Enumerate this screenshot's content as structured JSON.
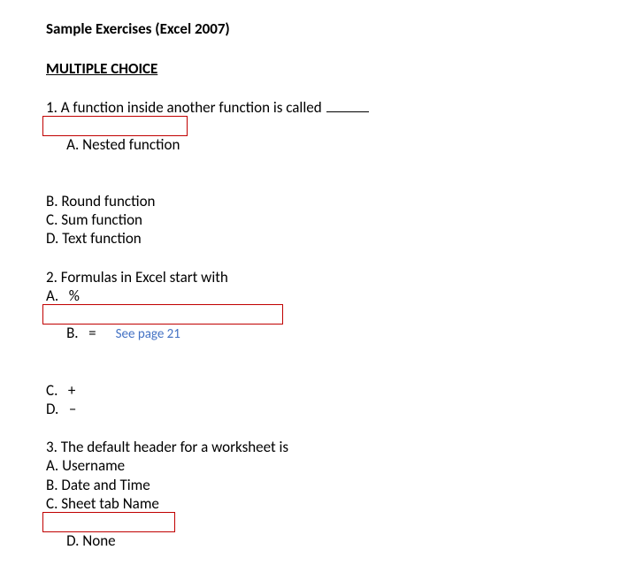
{
  "title": "Sample Exercises (Excel 2007)",
  "section": "MULTIPLE CHOICE",
  "q1": {
    "prompt_prefix": "1. A function inside another function is called ",
    "a": "A. Nested function",
    "b": "B. Round function",
    "c": "C. Sum function",
    "d": "D. Text function"
  },
  "q2": {
    "prompt": "2. Formulas in Excel start with",
    "a": "A.   %",
    "b": "B.   =",
    "c": "C.   +",
    "d": "D.   –",
    "annotation": "See page 21"
  },
  "q3": {
    "prompt": "3. The default header for a worksheet is",
    "a": "A. Username",
    "b": "B. Date and Time",
    "c": "C. Sheet tab Name",
    "d": "D. None"
  }
}
